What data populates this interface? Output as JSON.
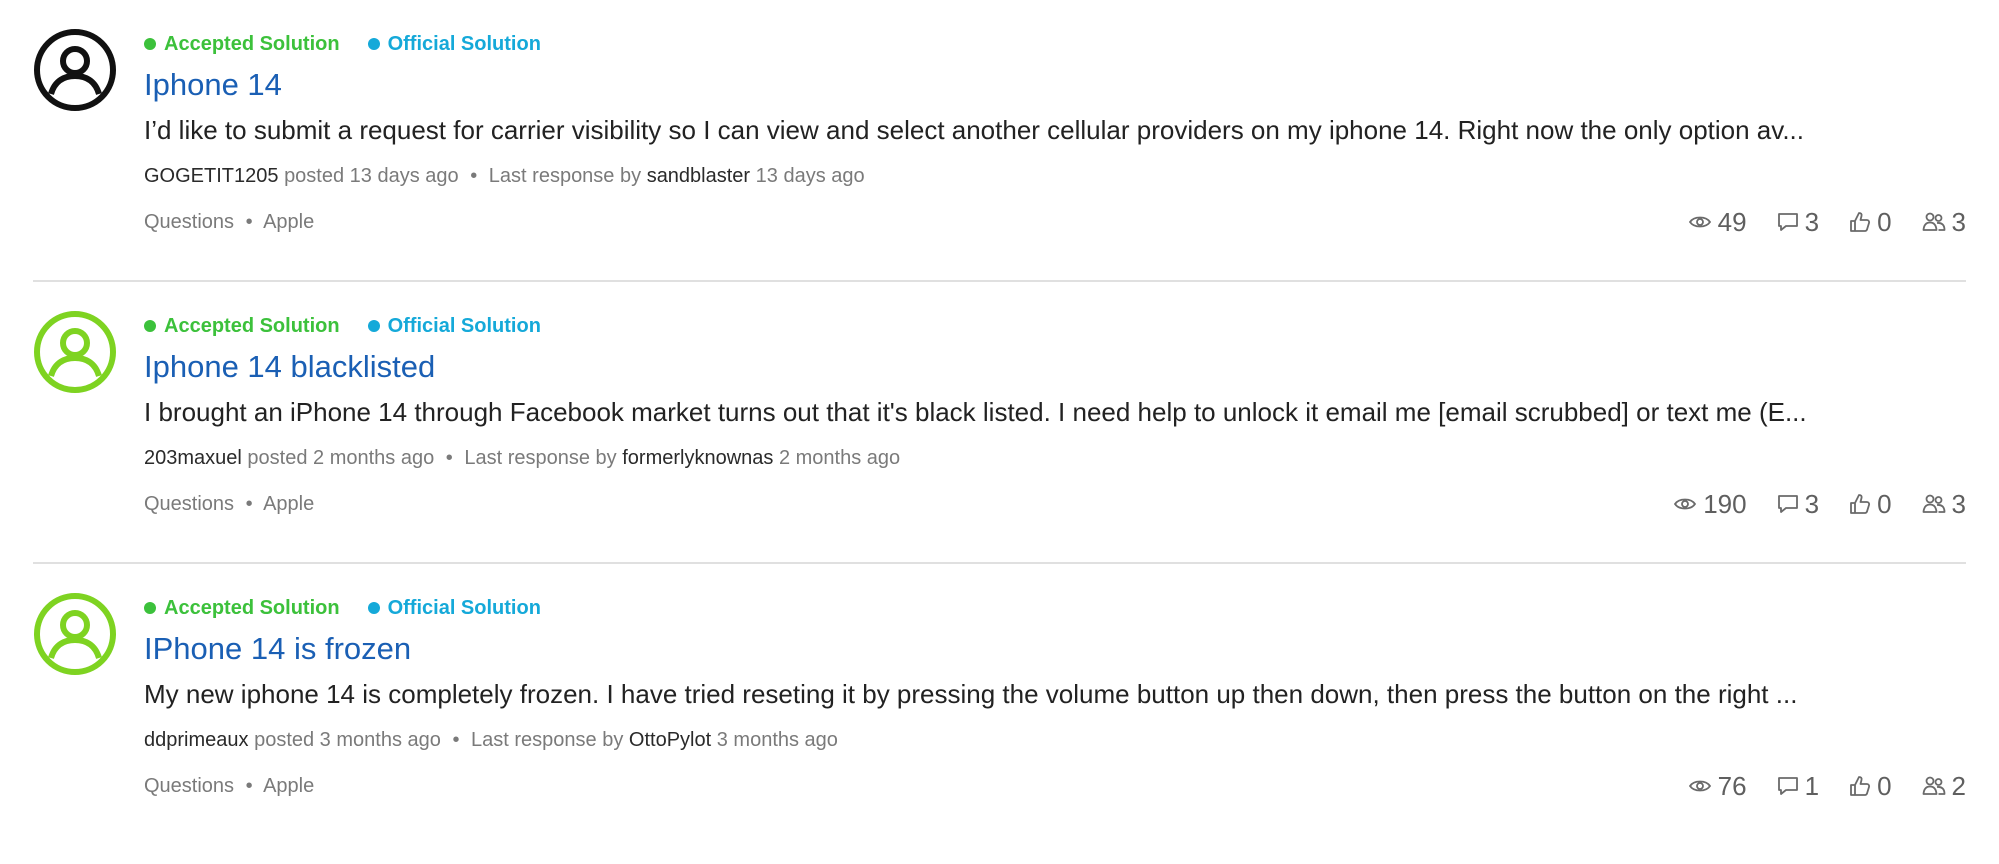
{
  "threads": [
    {
      "avatar_color": "#111111",
      "badges": {
        "accepted": "Accepted Solution",
        "official": "Official Solution"
      },
      "title": "Iphone 14",
      "excerpt": "I’d like to submit a request for carrier visibility so I can view and select another cellular providers on my iphone 14. Right now the only option av...",
      "author": "GOGETIT1205",
      "posted": "posted 13 days ago",
      "bullet": "•",
      "last_response_label": "Last response by",
      "responder": "sandblaster",
      "response_time": "13 days ago",
      "category": "Questions",
      "tag": "Apple",
      "stats": {
        "views": "49",
        "replies": "3",
        "likes": "0",
        "participants": "3"
      }
    },
    {
      "avatar_color": "#7ed321",
      "badges": {
        "accepted": "Accepted Solution",
        "official": "Official Solution"
      },
      "title": "Iphone 14 blacklisted",
      "excerpt": "I brought an iPhone 14 through Facebook market turns out that it's black listed. I need help to unlock it email me [email scrubbed] or text me (E...",
      "author": "203maxuel",
      "posted": "posted 2 months ago",
      "bullet": "•",
      "last_response_label": "Last response by",
      "responder": "formerlyknownas",
      "response_time": "2 months ago",
      "category": "Questions",
      "tag": "Apple",
      "stats": {
        "views": "190",
        "replies": "3",
        "likes": "0",
        "participants": "3"
      }
    },
    {
      "avatar_color": "#7ed321",
      "badges": {
        "accepted": "Accepted Solution",
        "official": "Official Solution"
      },
      "title": "IPhone 14 is frozen",
      "excerpt": "My new iphone 14 is completely frozen. I have tried reseting it by pressing the volume button up then down, then press the button on the right ...",
      "author": "ddprimeaux",
      "posted": "posted 3 months ago",
      "bullet": "•",
      "last_response_label": "Last response by",
      "responder": "OttoPylot",
      "response_time": "3 months ago",
      "category": "Questions",
      "tag": "Apple",
      "stats": {
        "views": "76",
        "replies": "1",
        "likes": "0",
        "participants": "2"
      }
    }
  ]
}
